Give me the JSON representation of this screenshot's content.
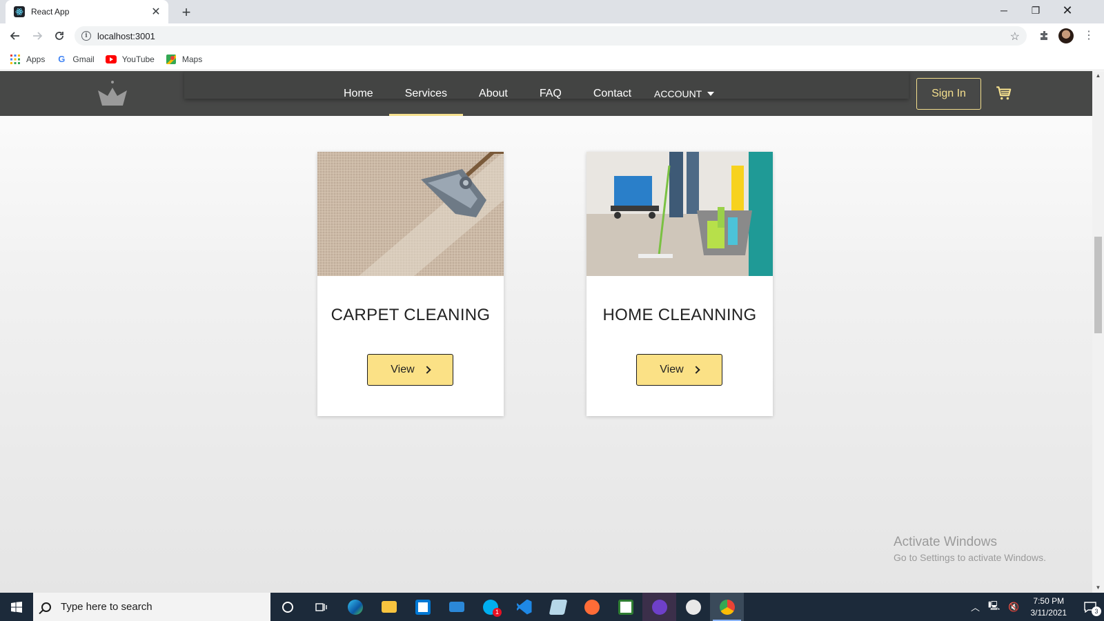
{
  "browser": {
    "tab_title": "React App",
    "url": "localhost:3001",
    "bookmarks": [
      {
        "label": "Apps",
        "icon": "apps-grid-icon"
      },
      {
        "label": "Gmail",
        "icon": "google-icon"
      },
      {
        "label": "YouTube",
        "icon": "youtube-icon"
      },
      {
        "label": "Maps",
        "icon": "maps-icon"
      }
    ]
  },
  "site": {
    "nav": {
      "items": [
        "Home",
        "Services",
        "About",
        "FAQ",
        "Contact"
      ],
      "active": "Services",
      "account_label": "ACCOUNT",
      "signin_label": "Sign In"
    },
    "services": [
      {
        "title": "CARPET CLEANING",
        "button": "View",
        "image": "vacuum-on-carpet-photo"
      },
      {
        "title": "HOME CLEANNING",
        "button": "View",
        "image": "cleaners-with-mop-and-supplies-photo"
      }
    ],
    "watermark": {
      "line1": "Activate Windows",
      "line2": "Go to Settings to activate Windows."
    },
    "colors": {
      "nav_bg": "#474847",
      "accent": "#f5e08e",
      "button_bg": "#fbe186"
    }
  },
  "taskbar": {
    "search_placeholder": "Type here to search",
    "time": "7:50 PM",
    "date": "3/11/2021",
    "skype_badge": "1",
    "notification_count": "3"
  }
}
